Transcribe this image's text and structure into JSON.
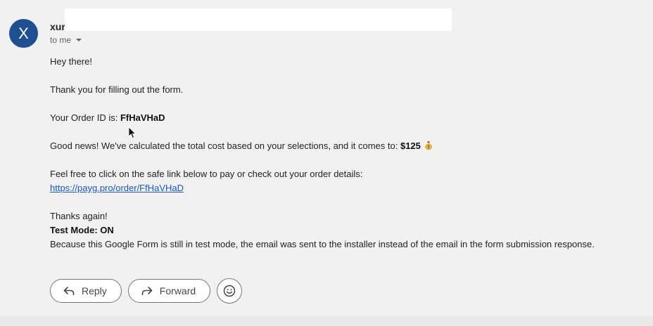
{
  "email": {
    "sender_initial": "X",
    "sender_name": "xur",
    "to_label": "to me",
    "greeting": "Hey there!",
    "thanks_line": "Thank you for filling out the form.",
    "order_id_label": "Your Order ID is: ",
    "order_id": "FfHaVHaD",
    "cost_text": "Good news! We've calculated the total cost based on your selections, and it comes to: ",
    "cost_amount": "$125",
    "link_intro": "Feel free to click on the safe link below to pay or check out your order details:",
    "link_text": "https://payg.pro/order/FfHaVHaD",
    "thanks_again": "Thanks again!",
    "test_mode": "Test Mode: ON",
    "test_mode_note": "Because this Google Form is still in test mode, the email was sent to the installer instead of the email in the form submission response."
  },
  "actions": {
    "reply_label": "Reply",
    "forward_label": "Forward"
  },
  "icons": {
    "reply": "reply-icon",
    "forward": "forward-icon",
    "emoji": "emoji-icon",
    "money_bag": "money-bag-icon",
    "dropdown": "chevron-down-icon"
  },
  "colors": {
    "avatar_bg": "#1d4f91",
    "link": "#1a57c2",
    "background": "#f1f1f1"
  }
}
